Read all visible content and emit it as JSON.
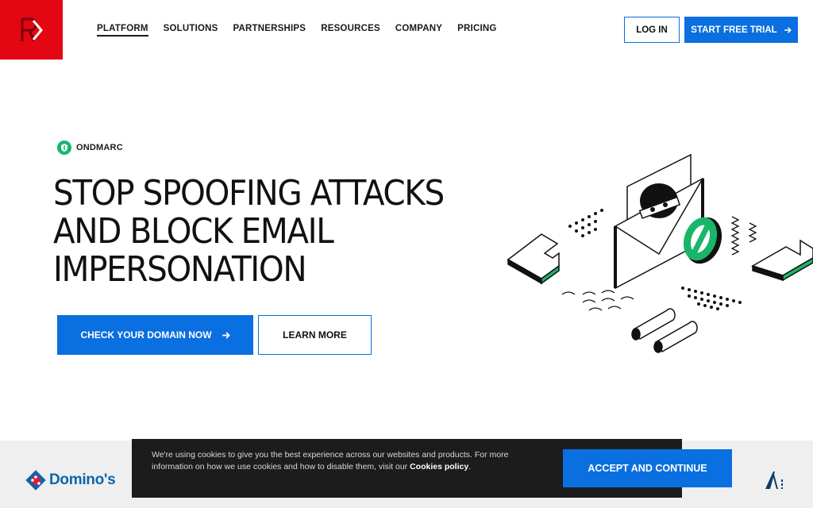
{
  "header": {
    "nav": [
      {
        "label": "PLATFORM",
        "active": true
      },
      {
        "label": "SOLUTIONS"
      },
      {
        "label": "PARTNERSHIPS"
      },
      {
        "label": "RESOURCES"
      },
      {
        "label": "COMPANY"
      },
      {
        "label": "PRICING"
      }
    ],
    "login_label": "LOG IN",
    "trial_label": "START FREE TRIAL"
  },
  "hero": {
    "badge": "ONDMARC",
    "title_lines": [
      "STOP SPOOFING ATTACKS",
      "AND BLOCK EMAIL",
      "IMPERSONATION"
    ],
    "primary_cta": "CHECK YOUR DOMAIN NOW",
    "secondary_cta": "LEARN MORE"
  },
  "logos": {
    "dominos": "Domino's"
  },
  "cookie": {
    "text_before": "We're using cookies to give you the best experience across our websites and products. For more information on how we use cookies and how to disable them, visit our ",
    "link": "Cookies policy",
    "text_after": ".",
    "accept_label": "ACCEPT AND CONTINUE"
  },
  "colors": {
    "brand_red": "#e30613",
    "accent_blue": "#0a6fe0",
    "green": "#19b56a"
  }
}
